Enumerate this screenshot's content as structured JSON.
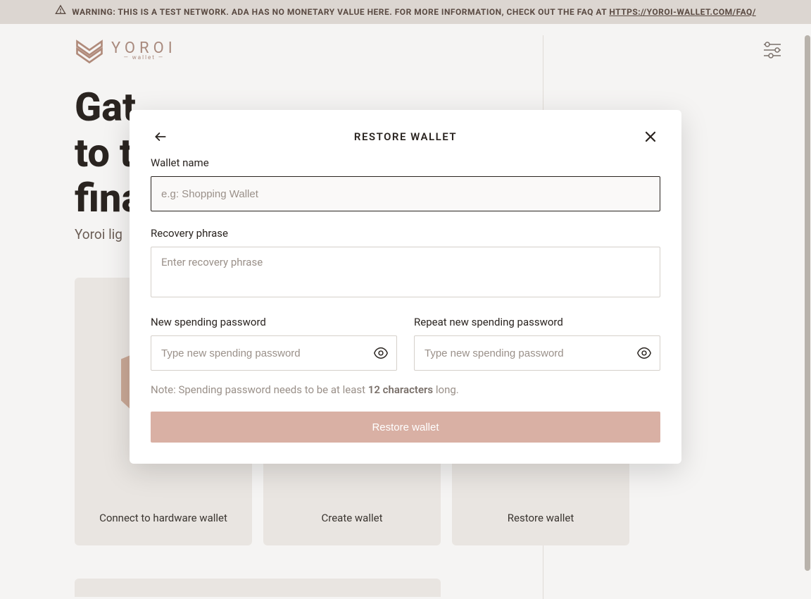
{
  "warning": {
    "prefix": "WARNING: THIS IS A TEST NETWORK. ADA HAS NO MONETARY VALUE HERE. FOR MORE INFORMATION, CHECK OUT THE FAQ AT ",
    "link_text": "HTTPS://YOROI-WALLET.COM/FAQ/"
  },
  "brand": {
    "name": "YOROI",
    "sub": "— wallet —"
  },
  "hero": {
    "title_line1": "Gat",
    "title_line2": "to t",
    "title_line3": "fina",
    "sub": "Yoroi lig"
  },
  "cards": {
    "connect_hw": "Connect to hardware wallet",
    "create": "Create wallet",
    "restore": "Restore wallet"
  },
  "modal": {
    "title": "RESTORE WALLET",
    "wallet_name_label": "Wallet name",
    "wallet_name_placeholder": "e.g: Shopping Wallet",
    "recovery_label": "Recovery phrase",
    "recovery_placeholder": "Enter recovery phrase",
    "new_pw_label": "New spending password",
    "repeat_pw_label": "Repeat new spending password",
    "pw_placeholder": "Type new spending password",
    "note_prefix": "Note: Spending password needs to be at least ",
    "note_bold": "12 characters",
    "note_suffix": " long.",
    "submit": "Restore wallet"
  }
}
